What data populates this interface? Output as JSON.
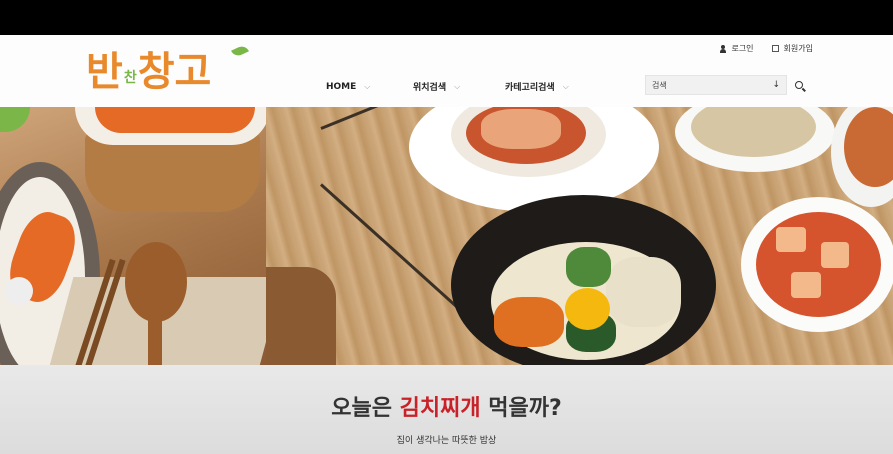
{
  "brand": {
    "logo_part1": "반",
    "logo_part2": "찬",
    "logo_part3": "창고",
    "colors": {
      "orange": "#e8892c",
      "green": "#7ab648",
      "accent_red": "#c82128"
    }
  },
  "top_links": [
    {
      "label": "로그인",
      "icon": "user-icon"
    },
    {
      "label": "회원가입",
      "icon": "edit-icon"
    }
  ],
  "nav": [
    {
      "label": "HOME"
    },
    {
      "label": "위치검색"
    },
    {
      "label": "카테고리검색"
    }
  ],
  "search": {
    "placeholder": "검색",
    "dropdown_icon": "arrow-down-icon",
    "button_icon": "search-icon"
  },
  "hero": {
    "headline_pre": "오늘은 ",
    "headline_highlight": "김치찌개",
    "headline_post": " 먹을까?",
    "subtitle": "집이 생각나는 따뜻한 밥상"
  }
}
